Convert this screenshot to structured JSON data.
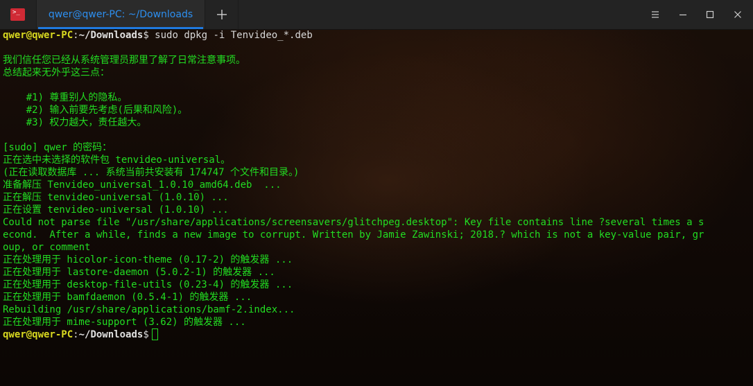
{
  "titlebar": {
    "app_icon_glyph": ">_",
    "tab_label": "qwer@qwer-PC: ~/Downloads",
    "new_tab_symbol": "+"
  },
  "colors": {
    "accent": "#1f7ae0",
    "terminal_text": "#22dd22",
    "prompt_user": "#d8d820",
    "app_icon_bg": "#d02a35"
  },
  "terminal": {
    "prompt_user": "qwer@qwer-PC",
    "prompt_sep": ":",
    "prompt_path": "~/Downloads",
    "prompt_dollar": "$",
    "command": " sudo dpkg -i Tenvideo_*.deb",
    "lines": [
      "",
      "我们信任您已经从系统管理员那里了解了日常注意事项。",
      "总结起来无外乎这三点：",
      "",
      "    #1) 尊重别人的隐私。",
      "    #2) 输入前要先考虑(后果和风险)。",
      "    #3) 权力越大，责任越大。",
      "",
      "[sudo] qwer 的密码：",
      "正在选中未选择的软件包 tenvideo-universal。",
      "(正在读取数据库 ... 系统当前共安装有 174747 个文件和目录。)",
      "准备解压 Tenvideo_universal_1.0.10_amd64.deb  ...",
      "正在解压 tenvideo-universal (1.0.10) ...",
      "正在设置 tenvideo-universal (1.0.10) ...",
      "Could not parse file \"/usr/share/applications/screensavers/glitchpeg.desktop\": Key file contains line ?several times a s",
      "econd.  After a while, finds a new image to corrupt. Written by Jamie Zawinski; 2018.? which is not a key-value pair, gr",
      "oup, or comment",
      "正在处理用于 hicolor-icon-theme (0.17-2) 的触发器 ...",
      "正在处理用于 lastore-daemon (5.0.2-1) 的触发器 ...",
      "正在处理用于 desktop-file-utils (0.23-4) 的触发器 ...",
      "正在处理用于 bamfdaemon (0.5.4-1) 的触发器 ...",
      "Rebuilding /usr/share/applications/bamf-2.index...",
      "正在处理用于 mime-support (3.62) 的触发器 ..."
    ]
  }
}
